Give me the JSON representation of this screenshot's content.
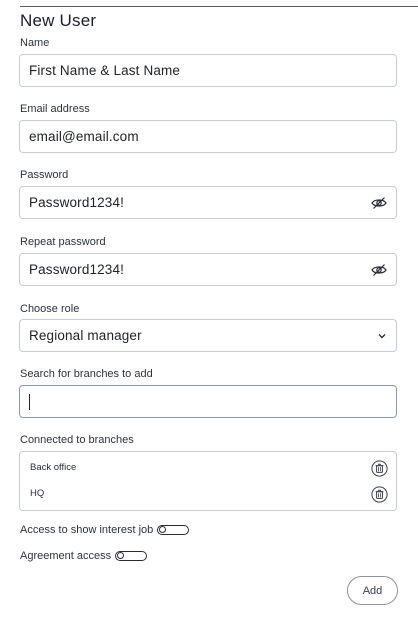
{
  "form": {
    "title": "New User",
    "name": {
      "label": "Name",
      "value": "First Name & Last Name"
    },
    "email": {
      "label": "Email address",
      "value": "email@email.com"
    },
    "password": {
      "label": "Password",
      "value": "Password1234!",
      "icon": "eye-slash-icon"
    },
    "repeat_password": {
      "label": "Repeat password",
      "value": "Password1234!",
      "icon": "eye-slash-icon"
    },
    "role": {
      "label": "Choose role",
      "selected": "Regional manager",
      "icon": "chevron-down-icon"
    },
    "branch_search": {
      "label": "Search for branches to add",
      "value": ""
    },
    "connected": {
      "label": "Connected to branches",
      "items": [
        {
          "name": "Back office",
          "icon": "trash-icon"
        },
        {
          "name": "HQ",
          "icon": "trash-icon"
        }
      ]
    },
    "toggles": {
      "show_interest_job": {
        "label": "Access to show interest job",
        "on": false
      },
      "agreement_access": {
        "label": "Agreement access",
        "on": false
      }
    },
    "add_label": "Add"
  }
}
